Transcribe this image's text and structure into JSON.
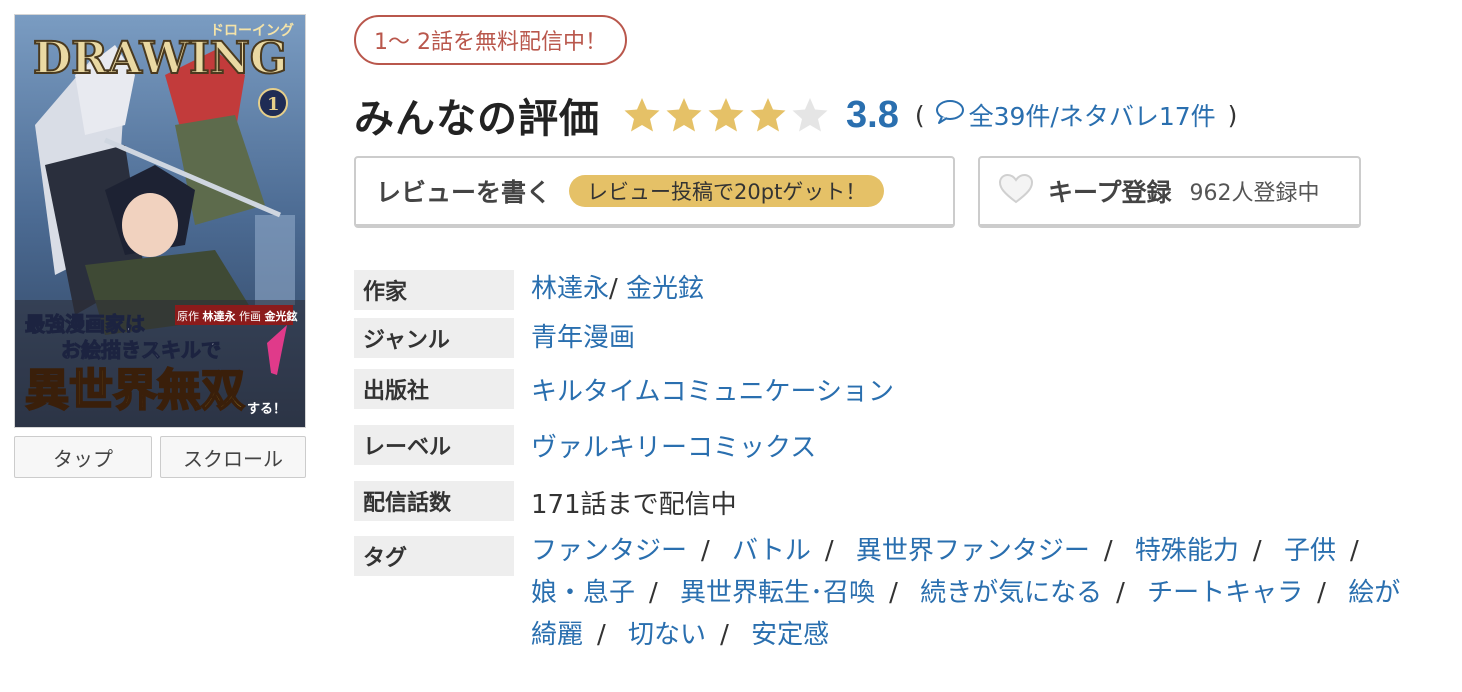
{
  "cover": {
    "logo_text": "DRAWING",
    "logo_kana": "ドローイング",
    "volume": "1",
    "subtitle_line1": "最強漫画家は",
    "subtitle_line2": "お絵描きスキルで",
    "title_main": "異世界無双",
    "title_suffix": "する！",
    "credit_original_tag": "原作",
    "credit_original": "林達永",
    "credit_art_tag": "作画",
    "credit_art": "金光鉉"
  },
  "view_buttons": {
    "tap": "タップ",
    "scroll": "スクロール"
  },
  "free_badge": "1〜 2話を無料配信中！",
  "rating": {
    "title": "みんなの評価",
    "score": "3.8",
    "stars_value": 3.8,
    "stars_max": 5,
    "open_paren": "(",
    "close_paren": ")",
    "reviews_link": "全39件/ネタバレ17件"
  },
  "review_button": {
    "label": "レビューを書く",
    "bonus": "レビュー投稿で20ptゲット！"
  },
  "keep_button": {
    "label": "キープ登録",
    "count": "962人登録中"
  },
  "info": {
    "author_label": "作家",
    "authors": [
      "林達永",
      "金光鉉"
    ],
    "author_sep": "/",
    "genre_label": "ジャンル",
    "genre": "青年漫画",
    "publisher_label": "出版社",
    "publisher": "キルタイムコミュニケーション",
    "label_label": "レーベル",
    "label": "ヴァルキリーコミックス",
    "episodes_label": "配信話数",
    "episodes": "171話まで配信中",
    "tags_label": "タグ",
    "tag_sep": "/",
    "tags": [
      "ファンタジー",
      "バトル",
      "異世界ファンタジー",
      "特殊能力",
      "子供",
      "娘・息子",
      "異世界転生･召喚",
      "続きが気になる",
      "チートキャラ",
      "絵が綺麗",
      "切ない",
      "安定感"
    ]
  },
  "colors": {
    "link": "#2a6faf",
    "badge": "#b9574c",
    "star": "#e5c167",
    "star_empty": "#e5e5e5",
    "pill": "#e5c167",
    "label_bg": "#eeeeee"
  }
}
